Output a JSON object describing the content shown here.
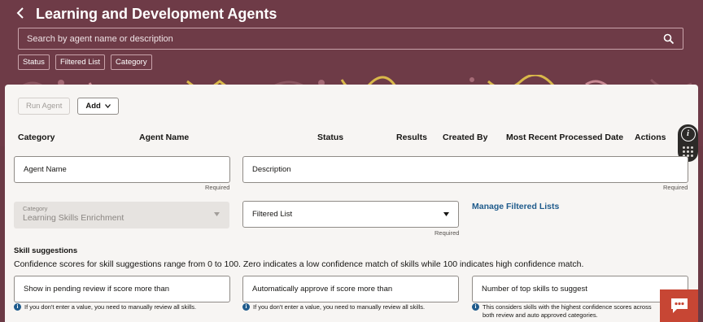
{
  "header": {
    "title": "Learning and Development Agents",
    "search_placeholder": "Search by agent name or description",
    "filters": [
      "Status",
      "Filtered List",
      "Category"
    ]
  },
  "toolbar": {
    "run_label": "Run Agent",
    "add_label": "Add"
  },
  "columns": [
    "Category",
    "Agent Name",
    "Status",
    "Results",
    "Created By",
    "Most Recent Processed Date",
    "Actions"
  ],
  "form": {
    "agent_name_label": "Agent Name",
    "description_label": "Description",
    "required_text": "Required",
    "category_label": "Category",
    "category_value": "Learning Skills Enrichment",
    "filtered_list_label": "Filtered List",
    "manage_link": "Manage Filtered Lists"
  },
  "skills": {
    "title": "Skill suggestions",
    "description": "Confidence scores for skill suggestions range from 0 to 100. Zero indicates a low confidence match of skills while 100 indicates high confidence match.",
    "pending_label": "Show in pending review if score more than",
    "approve_label": "Automatically approve if score more than",
    "top_label": "Number of top skills to suggest",
    "hint_manual": "If you don't enter a value, you need to manually review all skills.",
    "hint_top": "This considers skills with the highest confidence scores across both review and auto approved categories."
  },
  "colors": {
    "header": "#6e3b47",
    "accent": "#c74634",
    "link": "#1f5b8c"
  },
  "icons": [
    "back-chevron-icon",
    "search-icon",
    "caret-down-icon",
    "info-icon",
    "grid-dots-icon",
    "chat-icon"
  ]
}
